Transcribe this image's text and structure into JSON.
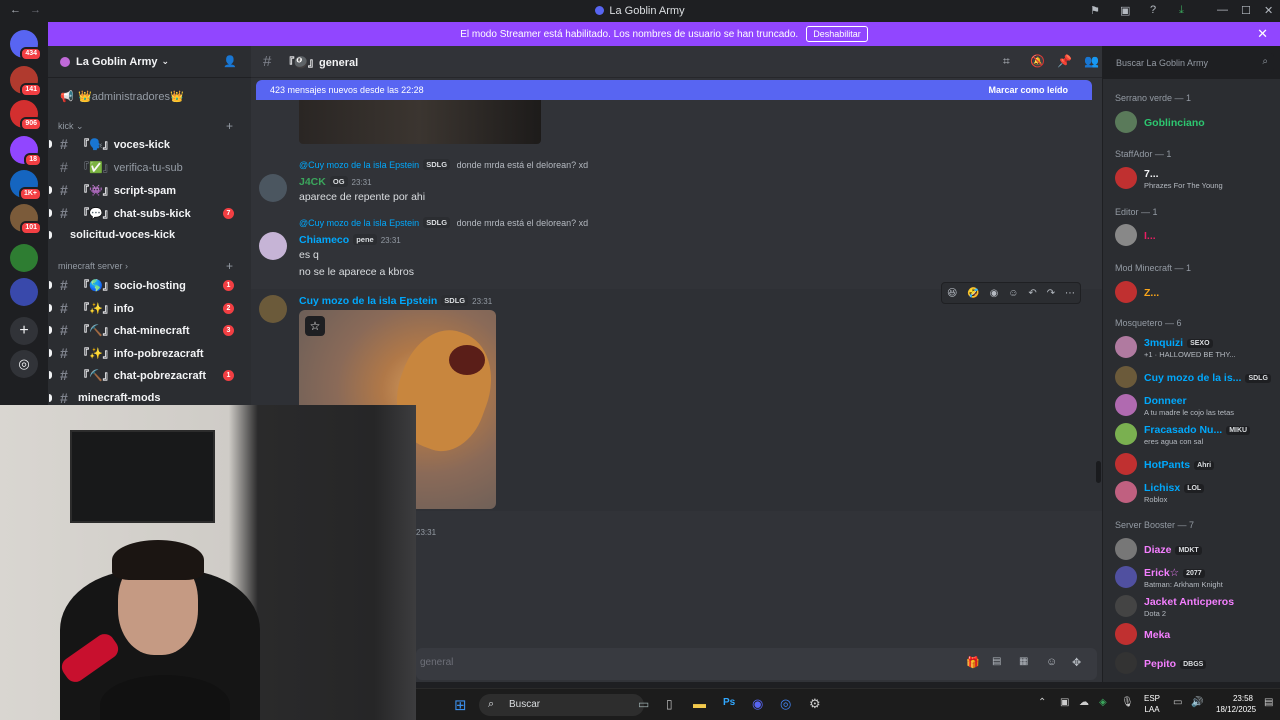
{
  "window": {
    "title": "La Goblin Army"
  },
  "banner": {
    "text": "El modo Streamer está habilitado. Los nombres de usuario se han truncado.",
    "button": "Deshabilitar"
  },
  "guilds": [
    {
      "badge": "434",
      "color": "#5865f2"
    },
    {
      "badge": "141",
      "color": "#b03a2e"
    },
    {
      "badge": "906",
      "color": "#d32f2f"
    },
    {
      "badge": "18",
      "color": "#9146ff"
    },
    {
      "badge": "1K+",
      "color": "#1565c0"
    },
    {
      "badge": "101",
      "color": "#7b5b3a"
    },
    {
      "badge": "",
      "color": "#2e7d32"
    },
    {
      "badge": "",
      "color": "#3949ab"
    }
  ],
  "server": {
    "name": "La Goblin Army"
  },
  "sidebar": {
    "admin_label": "👑administradores👑",
    "cat_kick": "kick",
    "cat_minecraft": "minecraft server",
    "channels": [
      {
        "label": "『🗣️』voces-kick",
        "count": ""
      },
      {
        "label": "『✅』verifica-tu-sub",
        "count": ""
      },
      {
        "label": "『👾』script-spam",
        "count": ""
      },
      {
        "label": "『💬』chat-subs-kick",
        "count": "7"
      },
      {
        "label": "solicitud-voces-kick",
        "count": ""
      },
      {
        "label": "『🌎』socio-hosting",
        "count": "1"
      },
      {
        "label": "『✨』info",
        "count": "2"
      },
      {
        "label": "『⛏️』chat-minecraft",
        "count": "3"
      },
      {
        "label": "『✨』info-pobrezacraft",
        "count": ""
      },
      {
        "label": "『⛏️』chat-pobrezacraft",
        "count": "1"
      },
      {
        "label": "minecraft-mods",
        "count": ""
      }
    ]
  },
  "channel": {
    "name": "『🎱』general",
    "search_placeholder": "Buscar La Goblin Army"
  },
  "newbar": {
    "text": "423 mensajes nuevos desde las 22:28",
    "mark": "Marcar como leído"
  },
  "messages": [
    {
      "reply_to": "@Cuy mozo de la isla Epstein",
      "reply_tag": "SDLG",
      "reply_text": "donde mrda está el delorean? xd",
      "author": "J4CK",
      "author_tag": "OG",
      "time": "23:31",
      "lines": [
        "aparece de repente por ahi"
      ],
      "color": "#3ba55c"
    },
    {
      "reply_to": "@Cuy mozo de la isla Epstein",
      "reply_tag": "SDLG",
      "reply_text": "donde mrda está el delorean? xd",
      "author": "Chiameco",
      "author_tag": "pene",
      "time": "23:31",
      "lines": [
        "es q",
        "no se le aparece a kbros"
      ],
      "color": "#00a8fc"
    },
    {
      "author": "Cuy mozo de la isla Epstein",
      "author_tag": "SDLG",
      "time": "23:31",
      "lines": [],
      "color": "#00a8fc"
    }
  ],
  "trailing_time": "23:31",
  "composer": {
    "placeholder": "general"
  },
  "members": {
    "groups": [
      {
        "label": "Serrano verde — 1"
      },
      {
        "label": "StaffAdor — 1"
      },
      {
        "label": "Editor — 1"
      },
      {
        "label": "Mod Minecraft — 1"
      },
      {
        "label": "Mosquetero — 6"
      },
      {
        "label": "Server Booster — 7"
      }
    ],
    "list": [
      {
        "name": "Goblinciano",
        "status": "",
        "tag": "",
        "color": "#2dc770"
      },
      {
        "name": "7...",
        "status": "Phrazes For The Young",
        "tag": "",
        "color": "#f2f3f5"
      },
      {
        "name": "I...",
        "status": "",
        "tag": "",
        "color": "#e91e63"
      },
      {
        "name": "Z...",
        "status": "",
        "tag": "",
        "color": "#faa61a"
      },
      {
        "name": "3mquizi",
        "status": "+1 · HALLOWED BE THY...",
        "tag": "SEXO",
        "color": "#00a8fc"
      },
      {
        "name": "Cuy mozo de la is...",
        "status": "",
        "tag": "SDLG",
        "color": "#00a8fc"
      },
      {
        "name": "Donneer",
        "status": "A tu madre le cojo las tetas",
        "tag": "",
        "color": "#00a8fc"
      },
      {
        "name": "Fracasado Nu...",
        "status": "eres agua con sal",
        "tag": "MIKU",
        "color": "#00a8fc"
      },
      {
        "name": "HotPants",
        "status": "",
        "tag": "Ahri",
        "color": "#00a8fc"
      },
      {
        "name": "Lichisx",
        "status": "Roblox",
        "tag": "LOL",
        "color": "#00a8fc"
      },
      {
        "name": "Diaze",
        "status": "",
        "tag": "MDKT",
        "color": "#f47fff"
      },
      {
        "name": "Erick☆",
        "status": "Batman: Arkham Knight",
        "tag": "2077",
        "color": "#f47fff"
      },
      {
        "name": "Jacket Anticperos",
        "status": "Dota 2",
        "tag": "",
        "color": "#f47fff"
      },
      {
        "name": "Meka",
        "status": "",
        "tag": "",
        "color": "#f47fff"
      },
      {
        "name": "Pepito",
        "status": "",
        "tag": "DBGS",
        "color": "#f47fff"
      }
    ]
  },
  "taskbar": {
    "search": "Buscar",
    "lang": "ESP",
    "lang2": "LAA",
    "time": "23:58",
    "date": "18/12/2025"
  }
}
